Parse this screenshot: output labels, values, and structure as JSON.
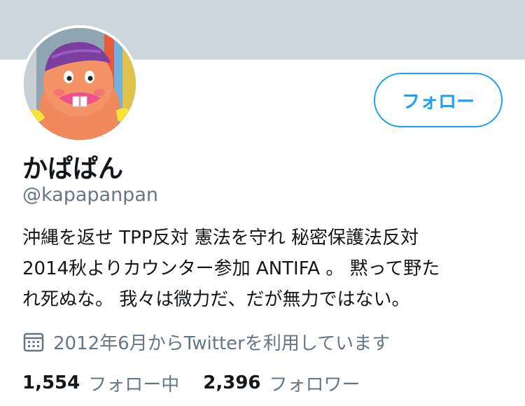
{
  "profile": {
    "display_name": "かぱぱん",
    "handle": "@kapapanpan",
    "follow_button": "フォロー",
    "bio_lines": [
      "沖縄を返せ TPP反対 憲法を守れ 秘密保護法反対",
      "2014秋よりカウンター参加 ANTIFA 。 黙って野た",
      "れ死ぬな。 我々は微力だ、だが無力ではない。"
    ],
    "joined": "2012年6月からTwitterを利用しています",
    "joined_icon": "calendar-icon",
    "following_count": "1,554",
    "following_label": "フォロー中",
    "followers_count": "2,396",
    "followers_label": "フォロワー"
  },
  "colors": {
    "banner": "#ccd6dd",
    "accent": "#1da1f2",
    "secondary_text": "#657786"
  }
}
